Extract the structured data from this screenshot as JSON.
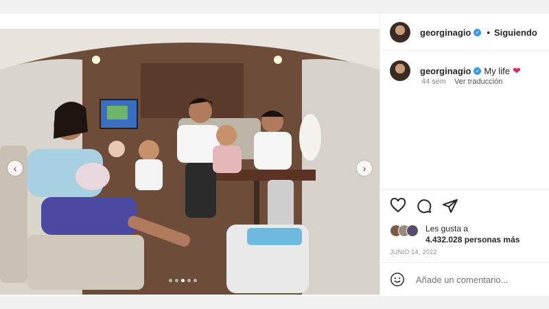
{
  "post": {
    "header": {
      "username": "georginagio",
      "separator": "•",
      "follow_status": "Siguiendo"
    },
    "caption": {
      "username": "georginagio",
      "text": "My life",
      "emoji": "heart-emoji",
      "age": "44 sem",
      "translate": "Ver traducción"
    },
    "carousel": {
      "total_slides": 5,
      "active_index": 2,
      "prev_icon": "‹",
      "next_icon": "›"
    },
    "actions": [
      "heart-icon",
      "comment-icon",
      "share-icon"
    ],
    "likes": {
      "prefix": "Les gusta a",
      "count_text": "4.432.028 personas más"
    },
    "date": "JUNIO 14, 2022",
    "comment_box": {
      "placeholder": "Añade un comentario..."
    }
  },
  "colors": {
    "verified": "#3897f0",
    "heart": "#e0245e",
    "muted": "#8e8e8e"
  }
}
